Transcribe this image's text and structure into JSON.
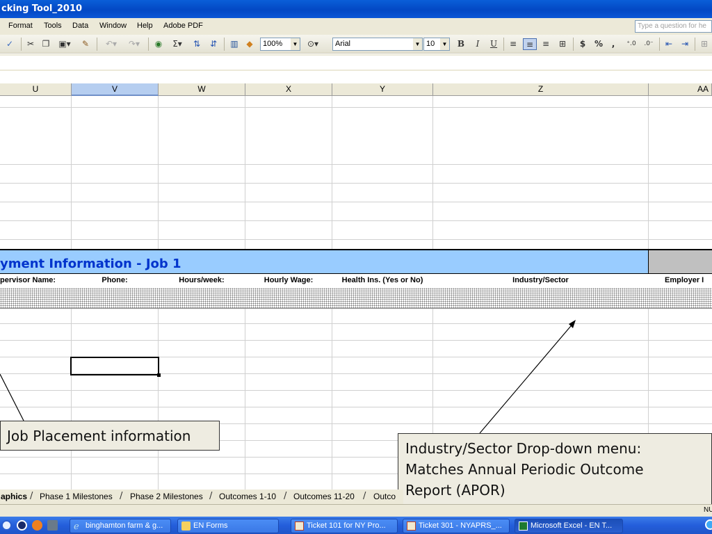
{
  "window": {
    "title": "cking Tool_2010"
  },
  "menu": {
    "items": [
      "Format",
      "Tools",
      "Data",
      "Window",
      "Help",
      "Adobe PDF"
    ],
    "ask_placeholder": "Type a question for he"
  },
  "toolbar": {
    "zoom": "100%",
    "font": "Arial",
    "font_size": "10",
    "bold": "B",
    "italic": "I",
    "underline": "U",
    "currency": "$",
    "percent": "%",
    "comma": ","
  },
  "columns": [
    "U",
    "V",
    "W",
    "X",
    "Y",
    "Z",
    "AA"
  ],
  "selected_column": "V",
  "section": {
    "title": "yment Information - Job 1"
  },
  "headers": {
    "supervisor": "pervisor Name:",
    "phone": "Phone:",
    "hours": "Hours/week:",
    "wage": "Hourly Wage:",
    "health": "Health Ins. (Yes or No)",
    "industry": "Industry/Sector",
    "employer": "Employer I"
  },
  "callouts": {
    "job_placement": "Job Placement information",
    "industry_line1": "Industry/Sector Drop-down menu:",
    "industry_line2": "Matches Annual Periodic Outcome",
    "industry_line3": "Report (APOR)"
  },
  "sheet_tabs": [
    "aphics",
    "Phase 1 Milestones",
    "Phase 2 Milestones",
    "Outcomes 1-10",
    "Outcomes 11-20",
    "Outco"
  ],
  "active_tab": "aphics",
  "status": {
    "num": "NU"
  },
  "taskbar": {
    "buttons": [
      "binghamton farm & g...",
      "EN Forms",
      "Ticket 101 for NY Pro...",
      "Ticket 301 - NYAPRS_...",
      "Microsoft Excel - EN T..."
    ]
  },
  "colors": {
    "title_blue": "#0348c4",
    "section_band": "#99ccff",
    "section_text": "#0033cc",
    "callout_bg": "#eeece1",
    "selected_col_header": "#b6cef0"
  }
}
